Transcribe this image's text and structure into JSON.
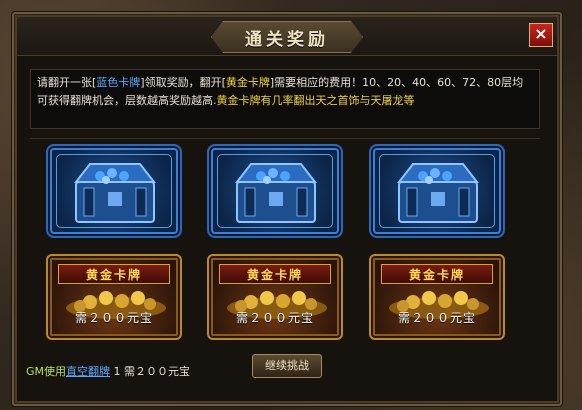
{
  "dialog": {
    "title": "通关奖励",
    "close_label": "×"
  },
  "description": {
    "part1": "请翻开一张[",
    "blue_card": "蓝色卡牌",
    "part2": "]领取奖励，翻开[",
    "gold_card": "黄金卡牌",
    "part3": "]需要相应的费用！10、20、40、60、72、80层均可获得翻牌机会，层数越高奖励越高.",
    "highlight": "黄金卡牌有几率翻出天之首饰与天屠龙等"
  },
  "blue_cards": [
    "blue",
    "blue",
    "blue"
  ],
  "gold_cards": [
    {
      "label": "黄金卡牌",
      "price": "需２００元宝"
    },
    {
      "label": "黄金卡牌",
      "price": "需２００元宝"
    },
    {
      "label": "黄金卡牌",
      "price": "需２００元宝"
    }
  ],
  "footer": {
    "gm_prefix": "GM使用",
    "gm_link": "直空翻牌",
    "gm_count": "1",
    "gm_price": "需２００元宝",
    "continue_label": "继续挑战"
  },
  "colors": {
    "blue_text": "#56a8ff",
    "yellow_text": "#f0d23a",
    "gold_border": "#b98a2a",
    "blue_border": "#2f66b5"
  }
}
